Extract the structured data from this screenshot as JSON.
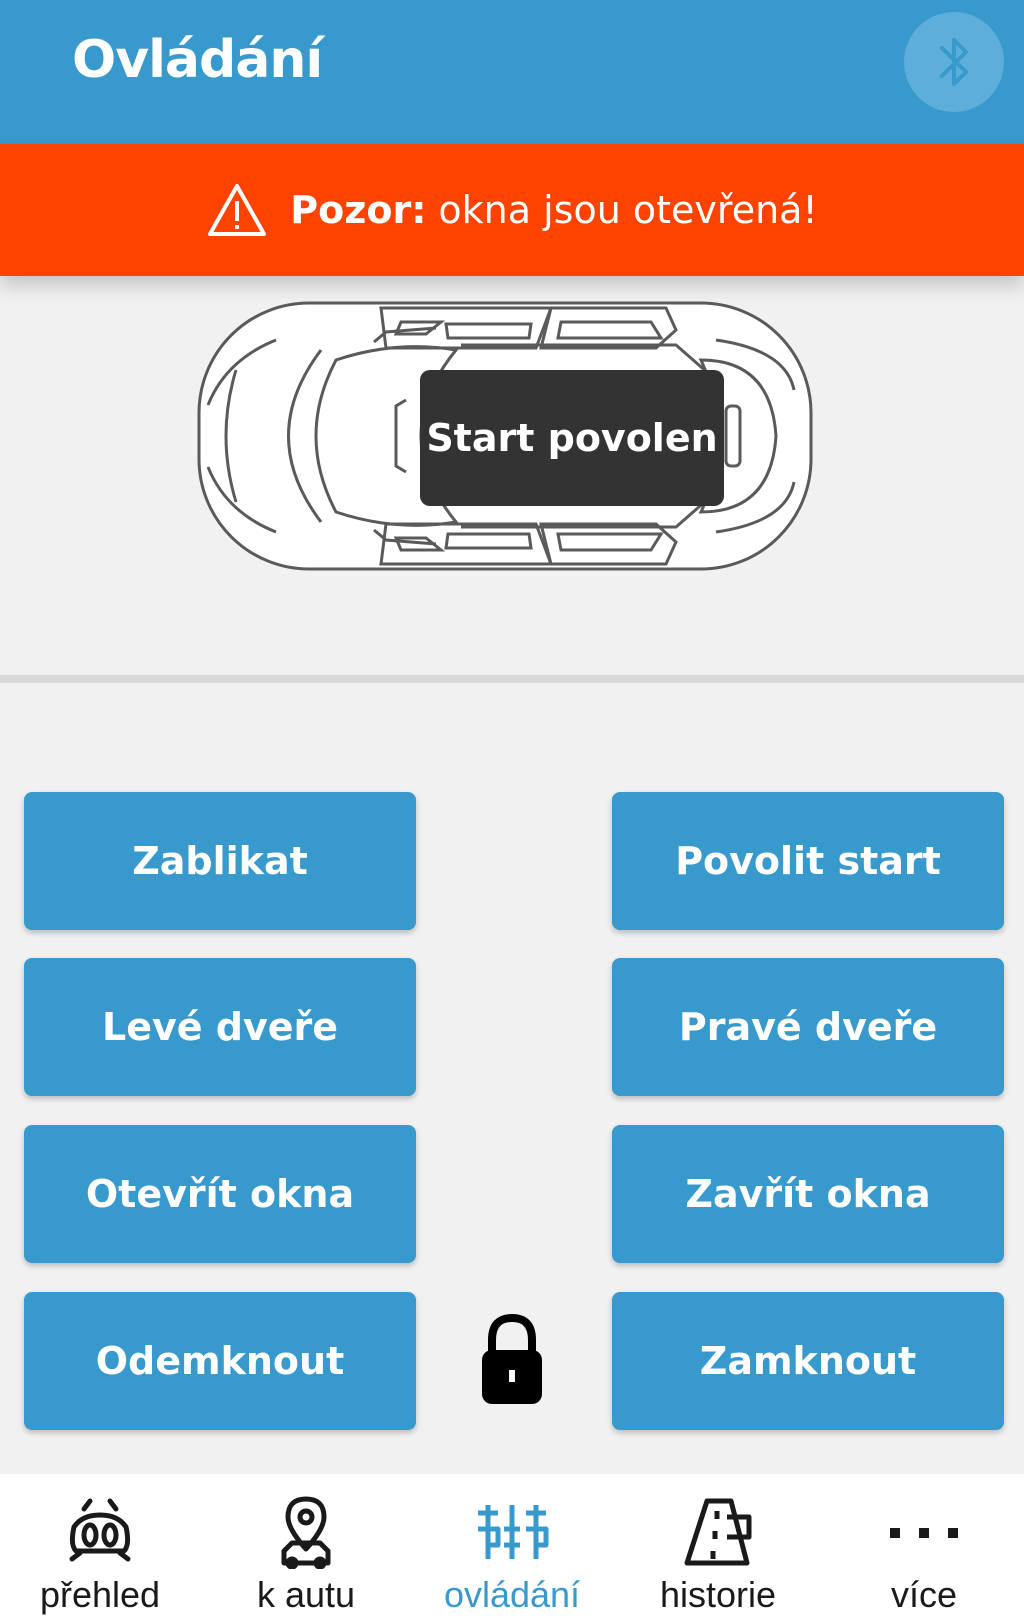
{
  "header": {
    "title": "Ovládání",
    "bluetooth_icon": "bluetooth-icon"
  },
  "alert": {
    "icon": "warning-icon",
    "label": "Pozor:",
    "message": "okna jsou otevřená!"
  },
  "car": {
    "status": "Start povolen"
  },
  "controls": {
    "flash": "Zablikat",
    "allow_start": "Povolit start",
    "left_door": "Levé dveře",
    "right_door": "Pravé dveře",
    "open_windows": "Otevřít okna",
    "close_windows": "Zavřít okna",
    "unlock": "Odemknout",
    "lock_status_icon": "lock-icon",
    "lock": "Zamknout"
  },
  "nav": {
    "items": [
      {
        "label": "přehled",
        "icon": "car-front-icon"
      },
      {
        "label": "k autu",
        "icon": "location-car-icon"
      },
      {
        "label": "ovládání",
        "icon": "controls-icon"
      },
      {
        "label": "historie",
        "icon": "road-flag-icon"
      },
      {
        "label": "více",
        "icon": "more-icon"
      }
    ],
    "active_index": 2
  },
  "colors": {
    "primary": "#3899cc",
    "alert": "#fe4300",
    "badge": "#333333",
    "background": "#f1f1f1"
  }
}
